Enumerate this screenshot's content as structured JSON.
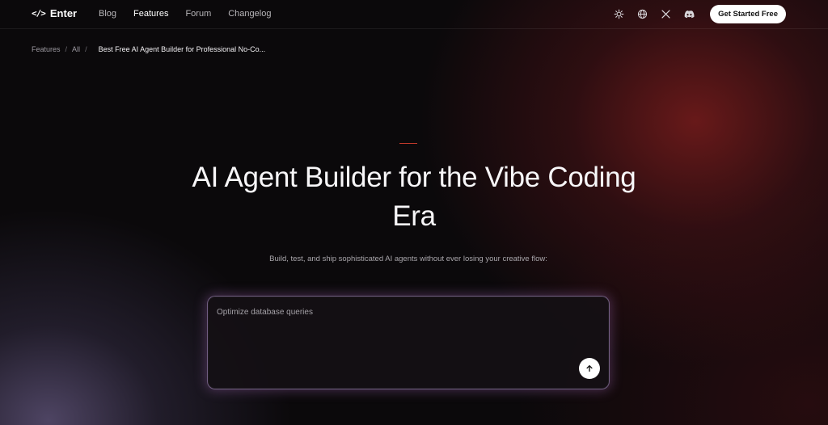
{
  "brand": {
    "name": "Enter",
    "icon": "code-slash-icon"
  },
  "nav": {
    "links": [
      {
        "label": "Blog",
        "active": false
      },
      {
        "label": "Features",
        "active": true
      },
      {
        "label": "Forum",
        "active": false
      },
      {
        "label": "Changelog",
        "active": false
      }
    ],
    "icons": [
      "sun-icon",
      "globe-icon",
      "x-twitter-icon",
      "discord-icon"
    ],
    "cta_label": "Get Started Free"
  },
  "breadcrumb": {
    "items": [
      "Features",
      "All"
    ],
    "separator": "/",
    "current": "Best Free AI Agent Builder for Professional No-Co..."
  },
  "hero": {
    "title": "AI Agent Builder for the Vibe Coding Era",
    "subtitle": "Build, test, and ship sophisticated AI agents without ever losing your creative flow:"
  },
  "prompt": {
    "placeholder": "Optimize database queries",
    "send_icon": "arrow-up-icon"
  },
  "colors": {
    "accent": "#c0392b",
    "background": "#0b090b",
    "cta_bg": "#ffffff"
  }
}
